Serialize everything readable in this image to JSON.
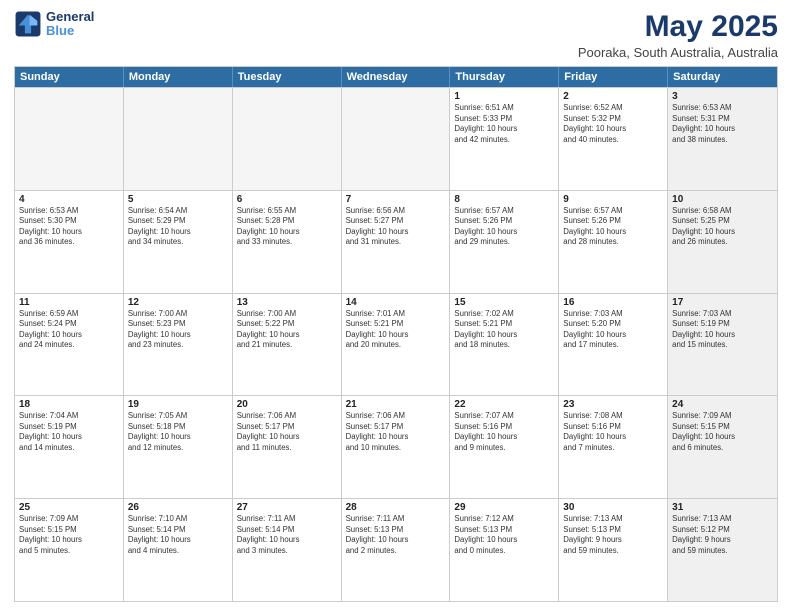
{
  "logo": {
    "line1": "General",
    "line2": "Blue"
  },
  "title": "May 2025",
  "subtitle": "Pooraka, South Australia, Australia",
  "headers": [
    "Sunday",
    "Monday",
    "Tuesday",
    "Wednesday",
    "Thursday",
    "Friday",
    "Saturday"
  ],
  "weeks": [
    [
      {
        "day": "",
        "info": "",
        "empty": true
      },
      {
        "day": "",
        "info": "",
        "empty": true
      },
      {
        "day": "",
        "info": "",
        "empty": true
      },
      {
        "day": "",
        "info": "",
        "empty": true
      },
      {
        "day": "1",
        "info": "Sunrise: 6:51 AM\nSunset: 5:33 PM\nDaylight: 10 hours\nand 42 minutes."
      },
      {
        "day": "2",
        "info": "Sunrise: 6:52 AM\nSunset: 5:32 PM\nDaylight: 10 hours\nand 40 minutes."
      },
      {
        "day": "3",
        "info": "Sunrise: 6:53 AM\nSunset: 5:31 PM\nDaylight: 10 hours\nand 38 minutes.",
        "shaded": true
      }
    ],
    [
      {
        "day": "4",
        "info": "Sunrise: 6:53 AM\nSunset: 5:30 PM\nDaylight: 10 hours\nand 36 minutes."
      },
      {
        "day": "5",
        "info": "Sunrise: 6:54 AM\nSunset: 5:29 PM\nDaylight: 10 hours\nand 34 minutes."
      },
      {
        "day": "6",
        "info": "Sunrise: 6:55 AM\nSunset: 5:28 PM\nDaylight: 10 hours\nand 33 minutes."
      },
      {
        "day": "7",
        "info": "Sunrise: 6:56 AM\nSunset: 5:27 PM\nDaylight: 10 hours\nand 31 minutes."
      },
      {
        "day": "8",
        "info": "Sunrise: 6:57 AM\nSunset: 5:26 PM\nDaylight: 10 hours\nand 29 minutes."
      },
      {
        "day": "9",
        "info": "Sunrise: 6:57 AM\nSunset: 5:26 PM\nDaylight: 10 hours\nand 28 minutes."
      },
      {
        "day": "10",
        "info": "Sunrise: 6:58 AM\nSunset: 5:25 PM\nDaylight: 10 hours\nand 26 minutes.",
        "shaded": true
      }
    ],
    [
      {
        "day": "11",
        "info": "Sunrise: 6:59 AM\nSunset: 5:24 PM\nDaylight: 10 hours\nand 24 minutes."
      },
      {
        "day": "12",
        "info": "Sunrise: 7:00 AM\nSunset: 5:23 PM\nDaylight: 10 hours\nand 23 minutes."
      },
      {
        "day": "13",
        "info": "Sunrise: 7:00 AM\nSunset: 5:22 PM\nDaylight: 10 hours\nand 21 minutes."
      },
      {
        "day": "14",
        "info": "Sunrise: 7:01 AM\nSunset: 5:21 PM\nDaylight: 10 hours\nand 20 minutes."
      },
      {
        "day": "15",
        "info": "Sunrise: 7:02 AM\nSunset: 5:21 PM\nDaylight: 10 hours\nand 18 minutes."
      },
      {
        "day": "16",
        "info": "Sunrise: 7:03 AM\nSunset: 5:20 PM\nDaylight: 10 hours\nand 17 minutes."
      },
      {
        "day": "17",
        "info": "Sunrise: 7:03 AM\nSunset: 5:19 PM\nDaylight: 10 hours\nand 15 minutes.",
        "shaded": true
      }
    ],
    [
      {
        "day": "18",
        "info": "Sunrise: 7:04 AM\nSunset: 5:19 PM\nDaylight: 10 hours\nand 14 minutes."
      },
      {
        "day": "19",
        "info": "Sunrise: 7:05 AM\nSunset: 5:18 PM\nDaylight: 10 hours\nand 12 minutes."
      },
      {
        "day": "20",
        "info": "Sunrise: 7:06 AM\nSunset: 5:17 PM\nDaylight: 10 hours\nand 11 minutes."
      },
      {
        "day": "21",
        "info": "Sunrise: 7:06 AM\nSunset: 5:17 PM\nDaylight: 10 hours\nand 10 minutes."
      },
      {
        "day": "22",
        "info": "Sunrise: 7:07 AM\nSunset: 5:16 PM\nDaylight: 10 hours\nand 9 minutes."
      },
      {
        "day": "23",
        "info": "Sunrise: 7:08 AM\nSunset: 5:16 PM\nDaylight: 10 hours\nand 7 minutes."
      },
      {
        "day": "24",
        "info": "Sunrise: 7:09 AM\nSunset: 5:15 PM\nDaylight: 10 hours\nand 6 minutes.",
        "shaded": true
      }
    ],
    [
      {
        "day": "25",
        "info": "Sunrise: 7:09 AM\nSunset: 5:15 PM\nDaylight: 10 hours\nand 5 minutes."
      },
      {
        "day": "26",
        "info": "Sunrise: 7:10 AM\nSunset: 5:14 PM\nDaylight: 10 hours\nand 4 minutes."
      },
      {
        "day": "27",
        "info": "Sunrise: 7:11 AM\nSunset: 5:14 PM\nDaylight: 10 hours\nand 3 minutes."
      },
      {
        "day": "28",
        "info": "Sunrise: 7:11 AM\nSunset: 5:13 PM\nDaylight: 10 hours\nand 2 minutes."
      },
      {
        "day": "29",
        "info": "Sunrise: 7:12 AM\nSunset: 5:13 PM\nDaylight: 10 hours\nand 0 minutes."
      },
      {
        "day": "30",
        "info": "Sunrise: 7:13 AM\nSunset: 5:13 PM\nDaylight: 9 hours\nand 59 minutes."
      },
      {
        "day": "31",
        "info": "Sunrise: 7:13 AM\nSunset: 5:12 PM\nDaylight: 9 hours\nand 59 minutes.",
        "shaded": true
      }
    ]
  ]
}
